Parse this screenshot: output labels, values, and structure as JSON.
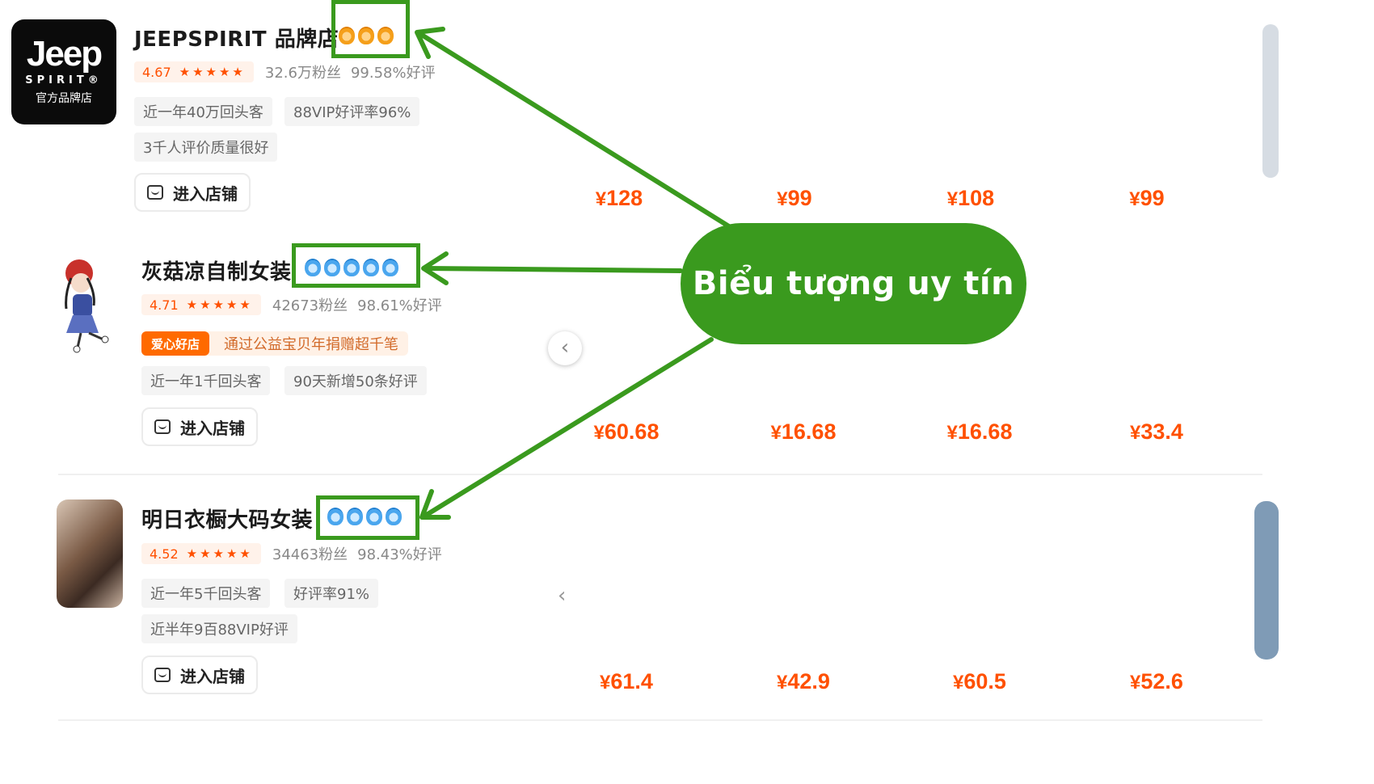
{
  "stores": [
    {
      "name": "JEEPSPIRIT 品牌店",
      "logo": {
        "brand": "Jeep",
        "sub": "SPIRIT®",
        "cn": "官方品牌店"
      },
      "rating": "4.67",
      "fans": "32.6万粉丝",
      "positive": "99.58%好评",
      "medal_type": "gold",
      "medal_count": 3,
      "tags": [
        "近一年40万回头客",
        "88VIP好评率96%",
        "3千人评价质量很好"
      ],
      "enter_label": "进入店铺",
      "products": [
        {
          "price": "128",
          "colors": [
            "#eef2f6",
            "#c9d3df",
            "#9aa9b8"
          ]
        },
        {
          "price": "99",
          "colors": [
            "#6f7477",
            "#a9c9e6",
            "#2d2d2d"
          ]
        },
        {
          "price": "108",
          "colors": [
            "#b6a99a",
            "#d8cfc4",
            "#6d5f53"
          ]
        },
        {
          "price": "99",
          "colors": [
            "#dfe6ee",
            "#8fb6d8",
            "#2b2b2b"
          ]
        }
      ]
    },
    {
      "name": "灰菇凉自制女装",
      "rating": "4.71",
      "fans": "42673粉丝",
      "positive": "98.61%好评",
      "medal_type": "blue",
      "medal_count": 5,
      "charity_badge": "爱心好店",
      "charity_text": "通过公益宝贝年捐赠超千笔",
      "tags": [
        "近一年1千回头客",
        "90天新增50条好评"
      ],
      "enter_label": "进入店铺",
      "products": [
        {
          "price": "60.68",
          "colors": [
            "#1c1c1c",
            "#5a4a3e",
            "#9b8a78"
          ]
        },
        {
          "price": "16.68",
          "colors": [
            "#f2e7a8",
            "#c8b56a",
            "#e9e4d6"
          ]
        },
        {
          "price": "16.68",
          "colors": [
            "#f6b3b5",
            "#f8d6d5",
            "#e58c93"
          ]
        },
        {
          "price": "33.4",
          "colors": [
            "#c9a98d",
            "#2e2e2e",
            "#5f7c63"
          ]
        }
      ]
    },
    {
      "name": "明日衣橱大码女装",
      "rating": "4.52",
      "fans": "34463粉丝",
      "positive": "98.43%好评",
      "medal_type": "blue",
      "medal_count": 4,
      "tags": [
        "近一年5千回头客",
        "好评率91%",
        "近半年9百88VIP好评"
      ],
      "enter_label": "进入店铺",
      "products": [
        {
          "price": "61.4",
          "colors": [
            "#8f8b93",
            "#c7c1c6",
            "#4b4448"
          ]
        },
        {
          "price": "42.9",
          "colors": [
            "#3a3a3a",
            "#f1ede6",
            "#8f8f8f"
          ]
        },
        {
          "price": "60.5",
          "colors": [
            "#7b8fa8",
            "#cfd6de",
            "#2d2d2d"
          ]
        },
        {
          "price": "52.6",
          "colors": [
            "#f1d7de",
            "#6f8a5e",
            "#e9e2dc"
          ]
        }
      ]
    }
  ],
  "annotation": {
    "label": "Biểu tượng uy tín",
    "color": "#3a9a1e"
  },
  "currency": "¥",
  "nav_prev_symbol": "‹"
}
